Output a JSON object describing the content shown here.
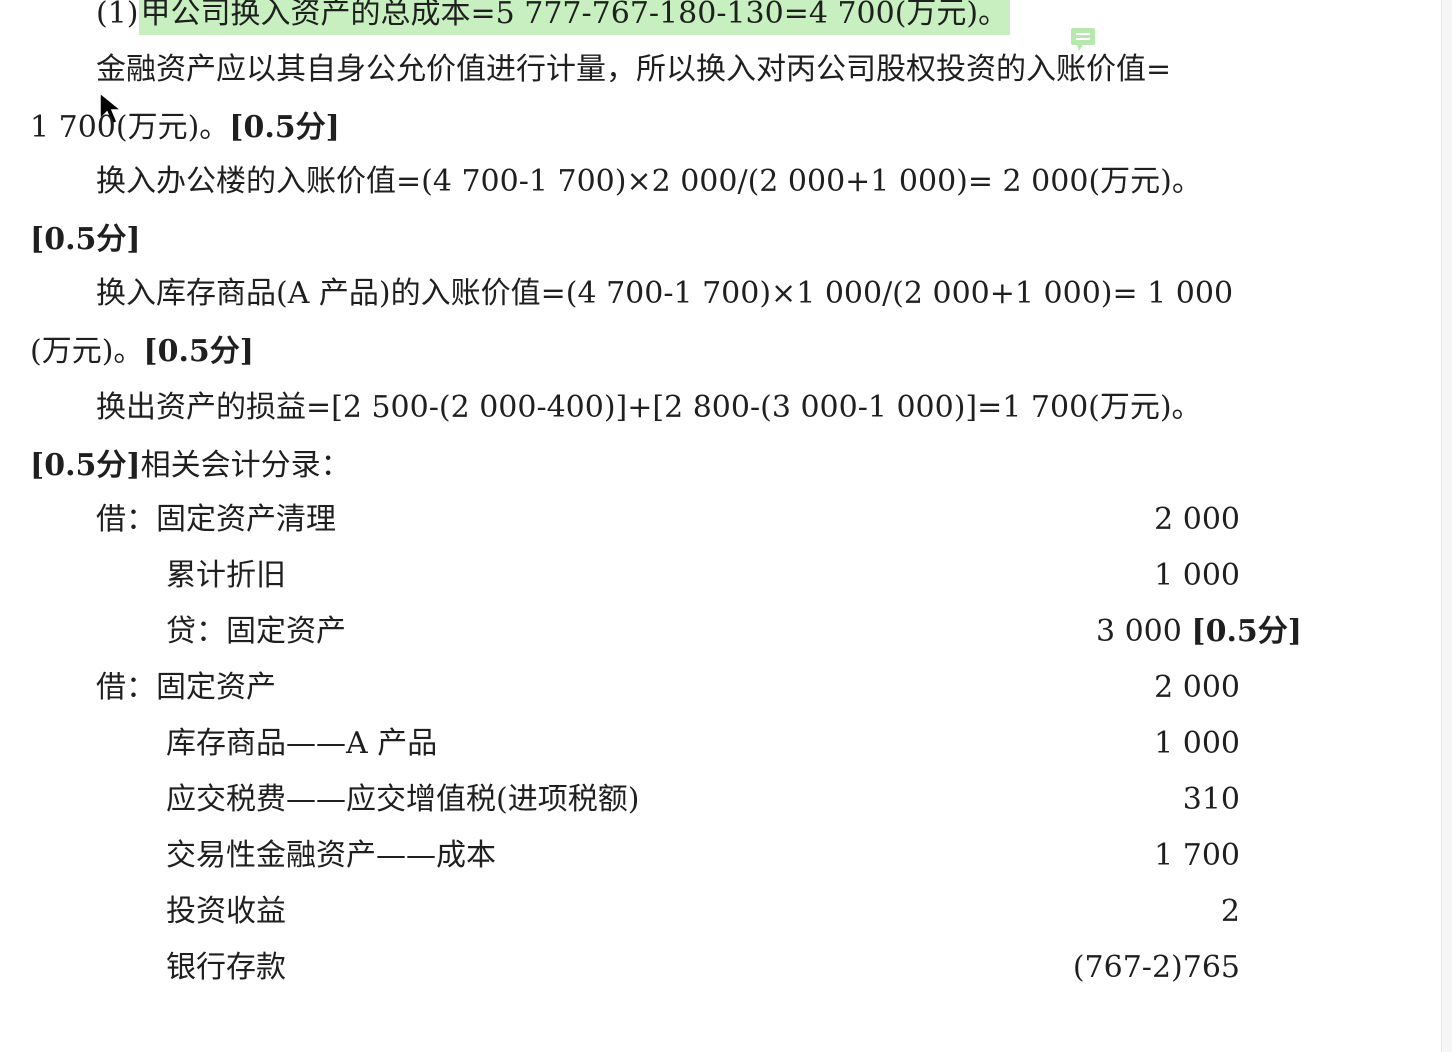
{
  "lines": [
    {
      "pre": "(1)",
      "highlight": "甲公司换入资产的总成本=5 777-767-180-130=4 700(万元)。"
    },
    {
      "text": "金融资产应以其自身公允价值进行计量，所以换入对丙公司股权投资的入账价值="
    },
    {
      "text": "1 700(万元)。",
      "score": "[0.5分]"
    },
    {
      "text": "换入办公楼的入账价值=(4 700-1 700)×2 000/(2 000+1 000)= 2 000(万元)。"
    },
    {
      "score": "[0.5分]"
    },
    {
      "text": "换入库存商品(A 产品)的入账价值=(4 700-1 700)×1 000/(2 000+1 000)= 1 000"
    },
    {
      "text": "(万元)。",
      "score": "[0.5分]"
    },
    {
      "text": "换出资产的损益=[2 500-(2 000-400)]+[2 800-(3 000-1 000)]=1 700(万元)。"
    },
    {
      "score": "[0.5分]",
      "text": "相关会计分录："
    }
  ],
  "entries": [
    {
      "account": "借：固定资产清理",
      "amount": "2 000"
    },
    {
      "account": "累计折旧",
      "amount": "1 000"
    },
    {
      "account": "贷：固定资产",
      "amount": "3 000",
      "score": "[0.5分]"
    },
    {
      "account": "借：固定资产",
      "amount": "2 000"
    },
    {
      "account": "库存商品——A 产品",
      "amount": "1 000"
    },
    {
      "account": "应交税费——应交增值税(进项税额)",
      "amount": "310"
    },
    {
      "account": "交易性金融资产——成本",
      "amount": "1 700"
    },
    {
      "account": "投资收益",
      "amount": "2"
    },
    {
      "account": "银行存款",
      "amount": "(767-2)765"
    }
  ],
  "icons": {
    "note": "comment-note-icon",
    "cursor": "mouse-pointer-icon"
  },
  "colors": {
    "highlight": "#c7efc0",
    "note_icon": "#b7e8ad",
    "text": "#1f1f1f"
  }
}
